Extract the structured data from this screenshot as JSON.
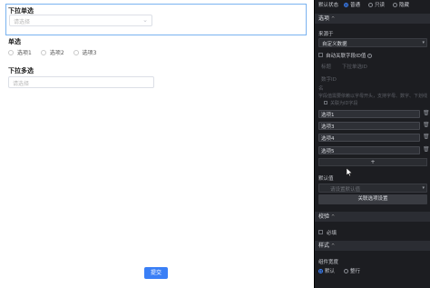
{
  "canvas": {
    "dropdown_single": {
      "label": "下拉单选",
      "placeholder": "请选择"
    },
    "radio": {
      "label": "单选",
      "options": [
        "选项1",
        "选项2",
        "选项3"
      ]
    },
    "dropdown_multi": {
      "label": "下拉多选",
      "placeholder": "请选择"
    },
    "submit_label": "提交"
  },
  "panel": {
    "default_state": {
      "label": "默认状态",
      "options": [
        "普通",
        "只读",
        "隐藏"
      ],
      "selected": "普通"
    },
    "options_section": "选项",
    "source_label": "来源于",
    "source_value": "自定义数据",
    "auto_link_label": "自动关联字段ID值",
    "tag_label": "标题",
    "tag_value": "下拉单选ID",
    "field_id_label": "数字ID",
    "field_id_note": "名",
    "hint_text": "字段值需要依赖以字母开头，支持字母、数字、下划线",
    "linked_field_label": "关联为ID字段",
    "option_items": [
      "选项1",
      "选项3",
      "选项4",
      "选项5"
    ],
    "add_symbol": "+",
    "default_value_label": "默认值",
    "default_value_placeholder": "请设置默认值",
    "linked_options_button": "关联选项设置",
    "validation_section": "校验",
    "required_label": "必填",
    "style_section": "样式",
    "component_width_label": "组件宽度",
    "width_options": [
      "默认",
      "整行"
    ],
    "width_selected": "默认"
  },
  "colors": {
    "accent": "#3a7ff6",
    "panel_bg": "#1c1d21",
    "section_bg": "#2b2d33"
  }
}
